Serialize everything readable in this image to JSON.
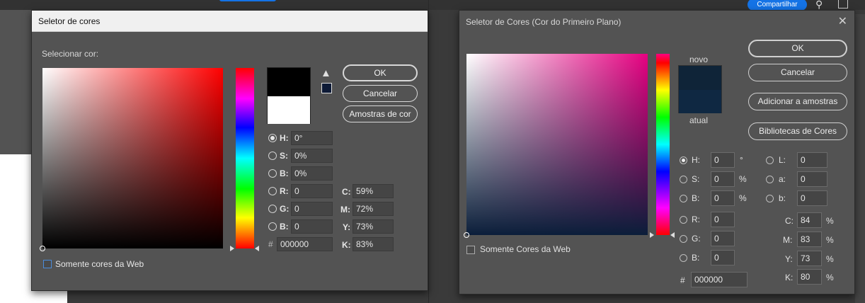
{
  "app": {
    "share_label": "Compartilhar"
  },
  "dialog1": {
    "title": "Seletor de cores",
    "select_label": "Selecionar cor:",
    "ok": "OK",
    "cancel": "Cancelar",
    "swatches": "Amostras de cor",
    "web_only": "Somente cores da Web",
    "hsb": [
      {
        "label": "H:",
        "value": "0°",
        "selected": true
      },
      {
        "label": "S:",
        "value": "0%",
        "selected": false
      },
      {
        "label": "B:",
        "value": "0%",
        "selected": false
      }
    ],
    "rgb": [
      {
        "label": "R:",
        "value": "0"
      },
      {
        "label": "G:",
        "value": "0"
      },
      {
        "label": "B:",
        "value": "0"
      }
    ],
    "cmyk": [
      {
        "label": "C:",
        "value": "59%"
      },
      {
        "label": "M:",
        "value": "72%"
      },
      {
        "label": "Y:",
        "value": "73%"
      },
      {
        "label": "K:",
        "value": "83%"
      }
    ],
    "hex_label": "#",
    "hex": "000000",
    "new_color": "#000000",
    "current_color": "#ffffff",
    "icons": [
      "warning-icon",
      "cube-icon"
    ]
  },
  "dialog2": {
    "title": "Seletor de Cores (Cor do Primeiro Plano)",
    "close": "✕",
    "new_label": "novo",
    "current_label": "atual",
    "ok": "OK",
    "cancel": "Cancelar",
    "add_swatches": "Adicionar a amostras",
    "libraries": "Bibliotecas de Cores",
    "web_only": "Somente Cores da Web",
    "hsb": [
      {
        "label": "H:",
        "value": "0",
        "unit": "°",
        "selected": true
      },
      {
        "label": "S:",
        "value": "0",
        "unit": "%",
        "selected": false
      },
      {
        "label": "B:",
        "value": "0",
        "unit": "%",
        "selected": false
      }
    ],
    "rgb": [
      {
        "label": "R:",
        "value": "0"
      },
      {
        "label": "G:",
        "value": "0"
      },
      {
        "label": "B:",
        "value": "0"
      }
    ],
    "lab": [
      {
        "label": "L:",
        "value": "0"
      },
      {
        "label": "a:",
        "value": "0"
      },
      {
        "label": "b:",
        "value": "0"
      }
    ],
    "cmyk": [
      {
        "label": "C:",
        "value": "84",
        "unit": "%"
      },
      {
        "label": "M:",
        "value": "83",
        "unit": "%"
      },
      {
        "label": "Y:",
        "value": "73",
        "unit": "%"
      },
      {
        "label": "K:",
        "value": "80",
        "unit": "%"
      }
    ],
    "hex_label": "#",
    "hex": "000000",
    "new_color": "#0f2438",
    "current_color": "#0f2842"
  }
}
